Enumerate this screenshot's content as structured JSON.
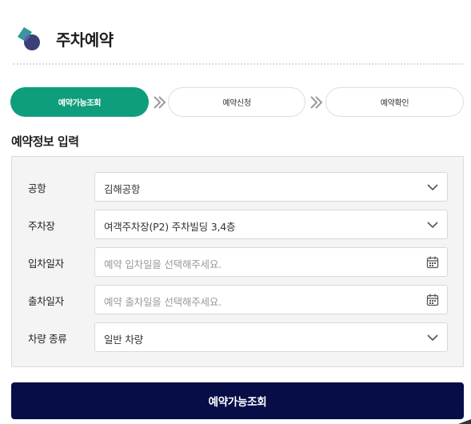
{
  "header": {
    "title": "주차예약",
    "logo_icon": "brand-logo-icon"
  },
  "steps": [
    {
      "label": "예약가능조회",
      "active": true
    },
    {
      "label": "예약신청",
      "active": false
    },
    {
      "label": "예약확인",
      "active": false
    }
  ],
  "form": {
    "section_title": "예약정보 입력",
    "airport": {
      "label": "공항",
      "value": "김해공항",
      "icon": "chevron-down-icon"
    },
    "parking": {
      "label": "주차장",
      "value": "여객주차장(P2) 주차빌딩 3,4층",
      "icon": "chevron-down-icon"
    },
    "entry_date": {
      "label": "입차일자",
      "placeholder": "예약 입차일을 선택해주세요.",
      "icon": "calendar-icon"
    },
    "exit_date": {
      "label": "출차일자",
      "placeholder": "예약 출차일을 선택해주세요.",
      "icon": "calendar-icon"
    },
    "vehicle": {
      "label": "차량 종류",
      "value": "일반 차량",
      "icon": "chevron-down-icon"
    }
  },
  "submit": {
    "label": "예약가능조회"
  },
  "colors": {
    "accent_green": "#0f9e7b",
    "navy": "#070d47",
    "logo_teal": "#1aa687",
    "logo_dark": "#2b2f6b"
  }
}
